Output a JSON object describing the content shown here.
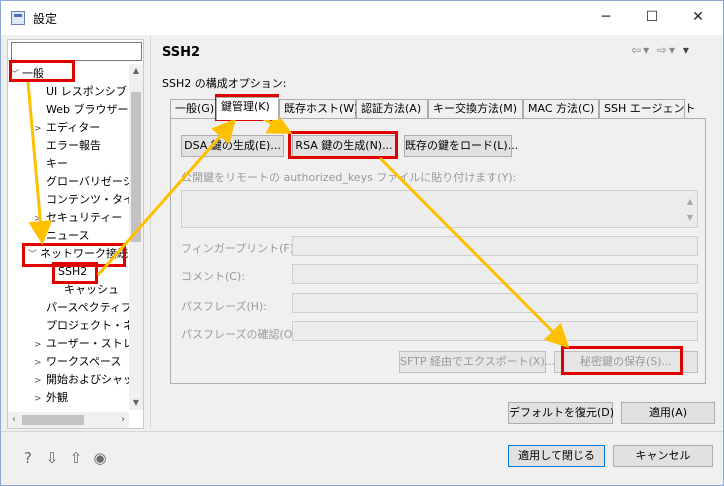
{
  "window": {
    "title": "設定",
    "minimize": "─",
    "maximize": "☐",
    "close": "✕"
  },
  "filter": {
    "value": ""
  },
  "tree": {
    "items": [
      {
        "label": "一般",
        "twisty": "﹀"
      },
      {
        "label": "UI レスポンシブ・モ",
        "twisty": ""
      },
      {
        "label": "Web ブラウザー",
        "twisty": ""
      },
      {
        "label": "エディター",
        "twisty": ">"
      },
      {
        "label": "エラー報告",
        "twisty": ""
      },
      {
        "label": "キー",
        "twisty": ""
      },
      {
        "label": "グローバリゼーショ",
        "twisty": ""
      },
      {
        "label": "コンテンツ・タイプ",
        "twisty": ""
      },
      {
        "label": "セキュリティー",
        "twisty": ">"
      },
      {
        "label": "ニュース",
        "twisty": ""
      },
      {
        "label": "ネットワーク接続",
        "twisty": "﹀"
      },
      {
        "label": "SSH2",
        "twisty": ""
      },
      {
        "label": "キャッシュ",
        "twisty": ""
      },
      {
        "label": "パースペクティブ",
        "twisty": ""
      },
      {
        "label": "プロジェクト・ネーラ",
        "twisty": ""
      },
      {
        "label": "ユーザー・ストレージ",
        "twisty": ">"
      },
      {
        "label": "ワークスペース",
        "twisty": ">"
      },
      {
        "label": "開始およびシャッ",
        "twisty": ">"
      },
      {
        "label": "外観",
        "twisty": ">"
      }
    ]
  },
  "page": {
    "title": "SSH2",
    "section_label": "SSH2 の構成オプション:"
  },
  "tabs": [
    {
      "label": "一般(G)"
    },
    {
      "label": "鍵管理(K)"
    },
    {
      "label": "既存ホスト(W)"
    },
    {
      "label": "認証方法(A)"
    },
    {
      "label": "キー交換方法(M)"
    },
    {
      "label": "MAC 方法(C)"
    },
    {
      "label": "SSH エージェント"
    }
  ],
  "key_mgmt": {
    "dsa_button": "DSA 鍵の生成(E)...",
    "rsa_button": "RSA 鍵の生成(N)...",
    "load_button": "既存の鍵をロード(L)...",
    "public_key_label": "公開鍵をリモートの authorized_keys ファイルに貼り付けます(Y):",
    "fingerprint_label": "フィンガープリント(F):",
    "comment_label": "コメント(C):",
    "passphrase_label": "パスフレーズ(H):",
    "passphrase_confirm_label": "パスフレーズの確認(O):",
    "sftp_export_button": "SFTP 経由でエクスポート(X)...",
    "save_private_key_button": "秘密鍵の保存(S)..."
  },
  "page_buttons": {
    "restore_defaults": "デフォルトを復元(D)",
    "apply": "適用(A)"
  },
  "footer": {
    "apply_and_close": "適用して閉じる",
    "cancel": "キャンセル",
    "icons": [
      "help-icon",
      "import-icon",
      "export-icon",
      "record-icon"
    ]
  },
  "colors": {
    "highlight": "#e00000",
    "arrow": "#ffc000",
    "default_button_border": "#0078d7"
  }
}
